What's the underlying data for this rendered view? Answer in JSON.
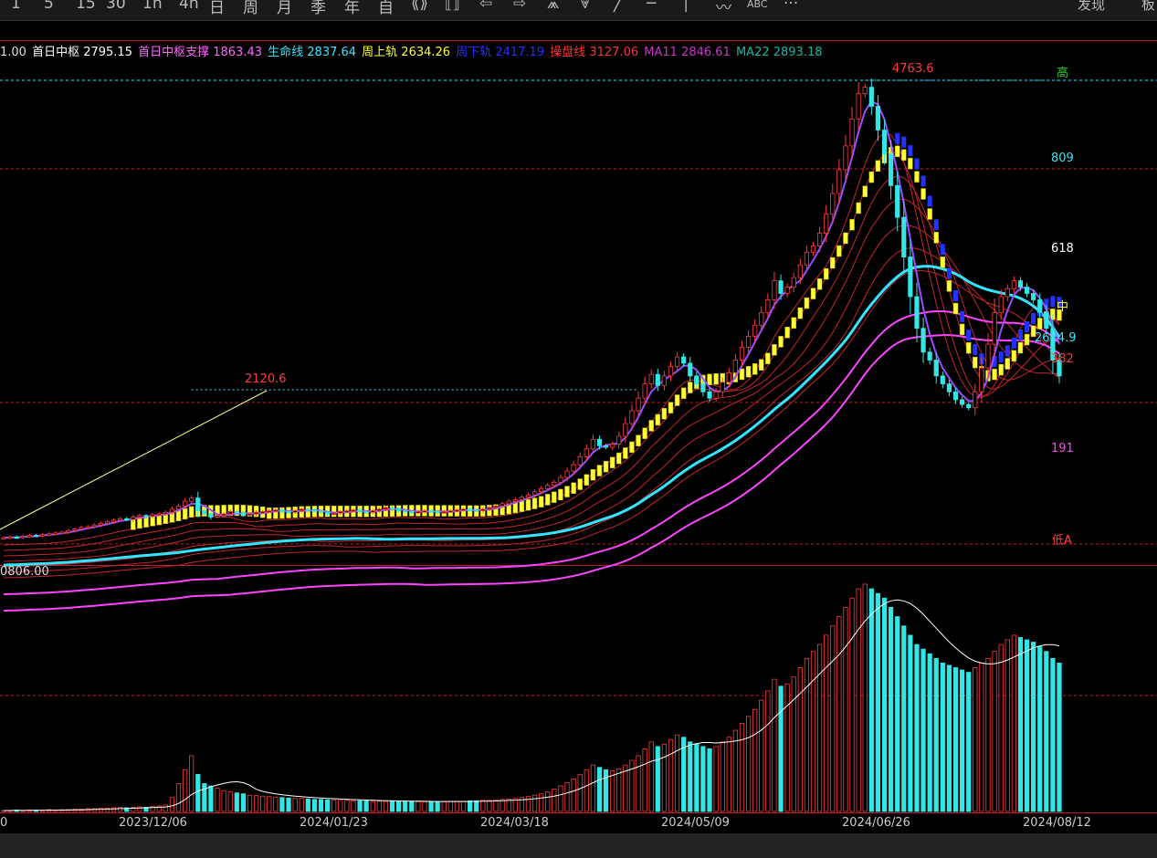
{
  "toolbar": {
    "items": [
      "1",
      "5",
      "15",
      "30",
      "1h",
      "4h",
      "日",
      "周",
      "月",
      "季",
      "年",
      "自",
      "⟪⟫",
      "⟦⟧",
      "⇦",
      "⇨",
      "⩕",
      "⩔",
      "╱",
      "─",
      "│",
      "〰",
      "ABC",
      "···"
    ],
    "right_items": [
      "发现",
      "板"
    ]
  },
  "legend": [
    {
      "label": "1.00",
      "color": "#dddddd"
    },
    {
      "label": "首日中枢 2795.15",
      "color": "#ffffff"
    },
    {
      "label": "首日中枢支撑 1863.43",
      "color": "#ff66ff"
    },
    {
      "label": "生命线 2837.64",
      "color": "#33e6ff"
    },
    {
      "label": "周上轨 2634.26",
      "color": "#ffff33"
    },
    {
      "label": "周下轨 2417.19",
      "color": "#2233ff"
    },
    {
      "label": "操盘线 3127.06",
      "color": "#ff3333"
    },
    {
      "label": "MA11 2846.61",
      "color": "#cc33cc"
    },
    {
      "label": "MA22 2893.18",
      "color": "#1ab5a0"
    }
  ],
  "price_labels": {
    "high": "4763.6",
    "low_peak": "2120.6",
    "gao": "高",
    "lv809": "809",
    "lv618": "618",
    "zhong": "中",
    "lv2624": "2624.9",
    "lv382": "382",
    "lv191": "191",
    "di": "低A"
  },
  "volume_label": "0806.00",
  "x_axis": [
    "0",
    "2023/12/06",
    "2024/01/23",
    "2024/03/18",
    "2024/05/09",
    "2024/06/26",
    "2024/08/12"
  ],
  "colors": {
    "up": "#ff3b3b",
    "down": "#33e6e6",
    "frame": "#b0222a",
    "week_upper": "#ffff33",
    "week_lower": "#2233ff",
    "lifeline": "#33e6ff",
    "support": "#ff44ff"
  },
  "chart_data": {
    "type": "candlestick",
    "ylim": [
      1863.43,
      4763.6
    ],
    "close": [
      1880,
      1885,
      1882,
      1890,
      1895,
      1893,
      1900,
      1905,
      1910,
      1915,
      1925,
      1935,
      1945,
      1950,
      1960,
      1970,
      1980,
      1990,
      2000,
      1995,
      2010,
      2020,
      2015,
      2025,
      2030,
      2040,
      2060,
      2080,
      2110,
      2130,
      2050,
      2030,
      2010,
      2020,
      2030,
      2045,
      2035,
      2025,
      2030,
      2040,
      2045,
      2050,
      2055,
      2045,
      2040,
      2050,
      2060,
      2055,
      2050,
      2040,
      2030,
      2035,
      2045,
      2050,
      2055,
      2045,
      2040,
      2050,
      2060,
      2070,
      2060,
      2050,
      2045,
      2040,
      2045,
      2050,
      2045,
      2040,
      2045,
      2050,
      2055,
      2060,
      2055,
      2050,
      2060,
      2070,
      2080,
      2095,
      2110,
      2120,
      2135,
      2150,
      2170,
      2190,
      2210,
      2230,
      2260,
      2300,
      2340,
      2390,
      2440,
      2500,
      2460,
      2450,
      2470,
      2520,
      2600,
      2680,
      2760,
      2850,
      2910,
      2840,
      2900,
      2960,
      3020,
      2980,
      2900,
      2850,
      2800,
      2760,
      2800,
      2860,
      2920,
      3000,
      3080,
      3150,
      3220,
      3300,
      3380,
      3500,
      3420,
      3460,
      3520,
      3600,
      3680,
      3720,
      3800,
      3920,
      4050,
      4200,
      4350,
      4520,
      4680,
      4720,
      4600,
      4450,
      4300,
      4100,
      3900,
      3650,
      3400,
      3200,
      3050,
      3000,
      2900,
      2850,
      2800,
      2750,
      2720,
      2700,
      2800,
      2950,
      3100,
      3300,
      3400,
      3450,
      3500,
      3460,
      3420,
      3380,
      3300,
      3200,
      3000,
      2900
    ],
    "volume": [
      2,
      2,
      3,
      2,
      3,
      3,
      3,
      4,
      3,
      4,
      4,
      5,
      5,
      6,
      6,
      7,
      7,
      8,
      9,
      8,
      9,
      10,
      9,
      11,
      12,
      14,
      30,
      60,
      90,
      120,
      80,
      60,
      55,
      50,
      45,
      42,
      40,
      38,
      35,
      34,
      33,
      32,
      31,
      30,
      29,
      28,
      28,
      27,
      26,
      26,
      25,
      25,
      24,
      24,
      23,
      23,
      23,
      22,
      22,
      22,
      22,
      22,
      22,
      21,
      21,
      21,
      21,
      21,
      21,
      22,
      22,
      22,
      23,
      23,
      24,
      24,
      25,
      26,
      27,
      28,
      30,
      32,
      35,
      38,
      42,
      48,
      55,
      62,
      70,
      80,
      90,
      100,
      95,
      90,
      88,
      92,
      100,
      110,
      120,
      135,
      150,
      140,
      145,
      155,
      165,
      160,
      150,
      145,
      140,
      135,
      140,
      150,
      160,
      175,
      190,
      205,
      220,
      240,
      260,
      285,
      270,
      275,
      290,
      310,
      330,
      345,
      360,
      380,
      400,
      420,
      440,
      460,
      480,
      490,
      480,
      470,
      460,
      440,
      420,
      400,
      380,
      360,
      350,
      340,
      330,
      320,
      315,
      310,
      305,
      300,
      310,
      320,
      330,
      345,
      360,
      370,
      380,
      375,
      370,
      365,
      355,
      345,
      330,
      320
    ]
  }
}
